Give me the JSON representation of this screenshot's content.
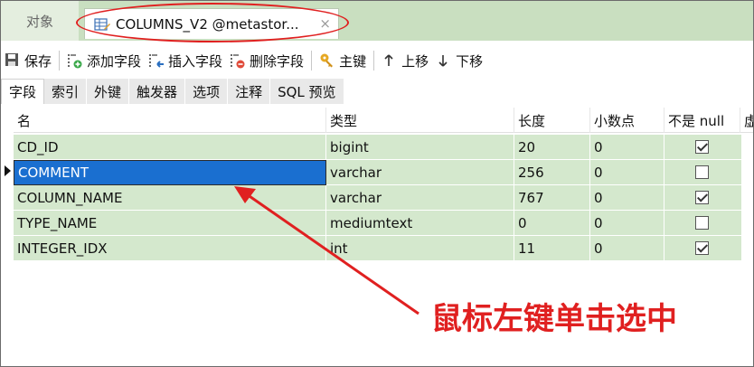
{
  "tabs": {
    "objects_label": "对象",
    "active_title": "COLUMNS_V2 @metastor...",
    "close_symbol": "×"
  },
  "toolbar": {
    "save": "保存",
    "add_field": "添加字段",
    "insert_field": "插入字段",
    "delete_field": "删除字段",
    "primary_key": "主键",
    "move_up": "上移",
    "move_down": "下移"
  },
  "subtabs": [
    "字段",
    "索引",
    "外键",
    "触发器",
    "选项",
    "注释",
    "SQL 预览"
  ],
  "columns": [
    "名",
    "类型",
    "长度",
    "小数点",
    "不是 null",
    "虚"
  ],
  "rows": [
    {
      "name": "CD_ID",
      "type": "bigint",
      "length": "20",
      "decimals": "0",
      "not_null": true
    },
    {
      "name": "COMMENT",
      "type": "varchar",
      "length": "256",
      "decimals": "0",
      "not_null": false
    },
    {
      "name": "COLUMN_NAME",
      "type": "varchar",
      "length": "767",
      "decimals": "0",
      "not_null": true
    },
    {
      "name": "TYPE_NAME",
      "type": "mediumtext",
      "length": "0",
      "decimals": "0",
      "not_null": false
    },
    {
      "name": "INTEGER_IDX",
      "type": "int",
      "length": "11",
      "decimals": "0",
      "not_null": true
    }
  ],
  "annotation": "鼠标左键单击选中",
  "colors": {
    "tab_bar": "#c9dfc0",
    "row_bg": "#d4e8cd",
    "selected": "#1a6fd0",
    "annotation": "#e02020"
  }
}
